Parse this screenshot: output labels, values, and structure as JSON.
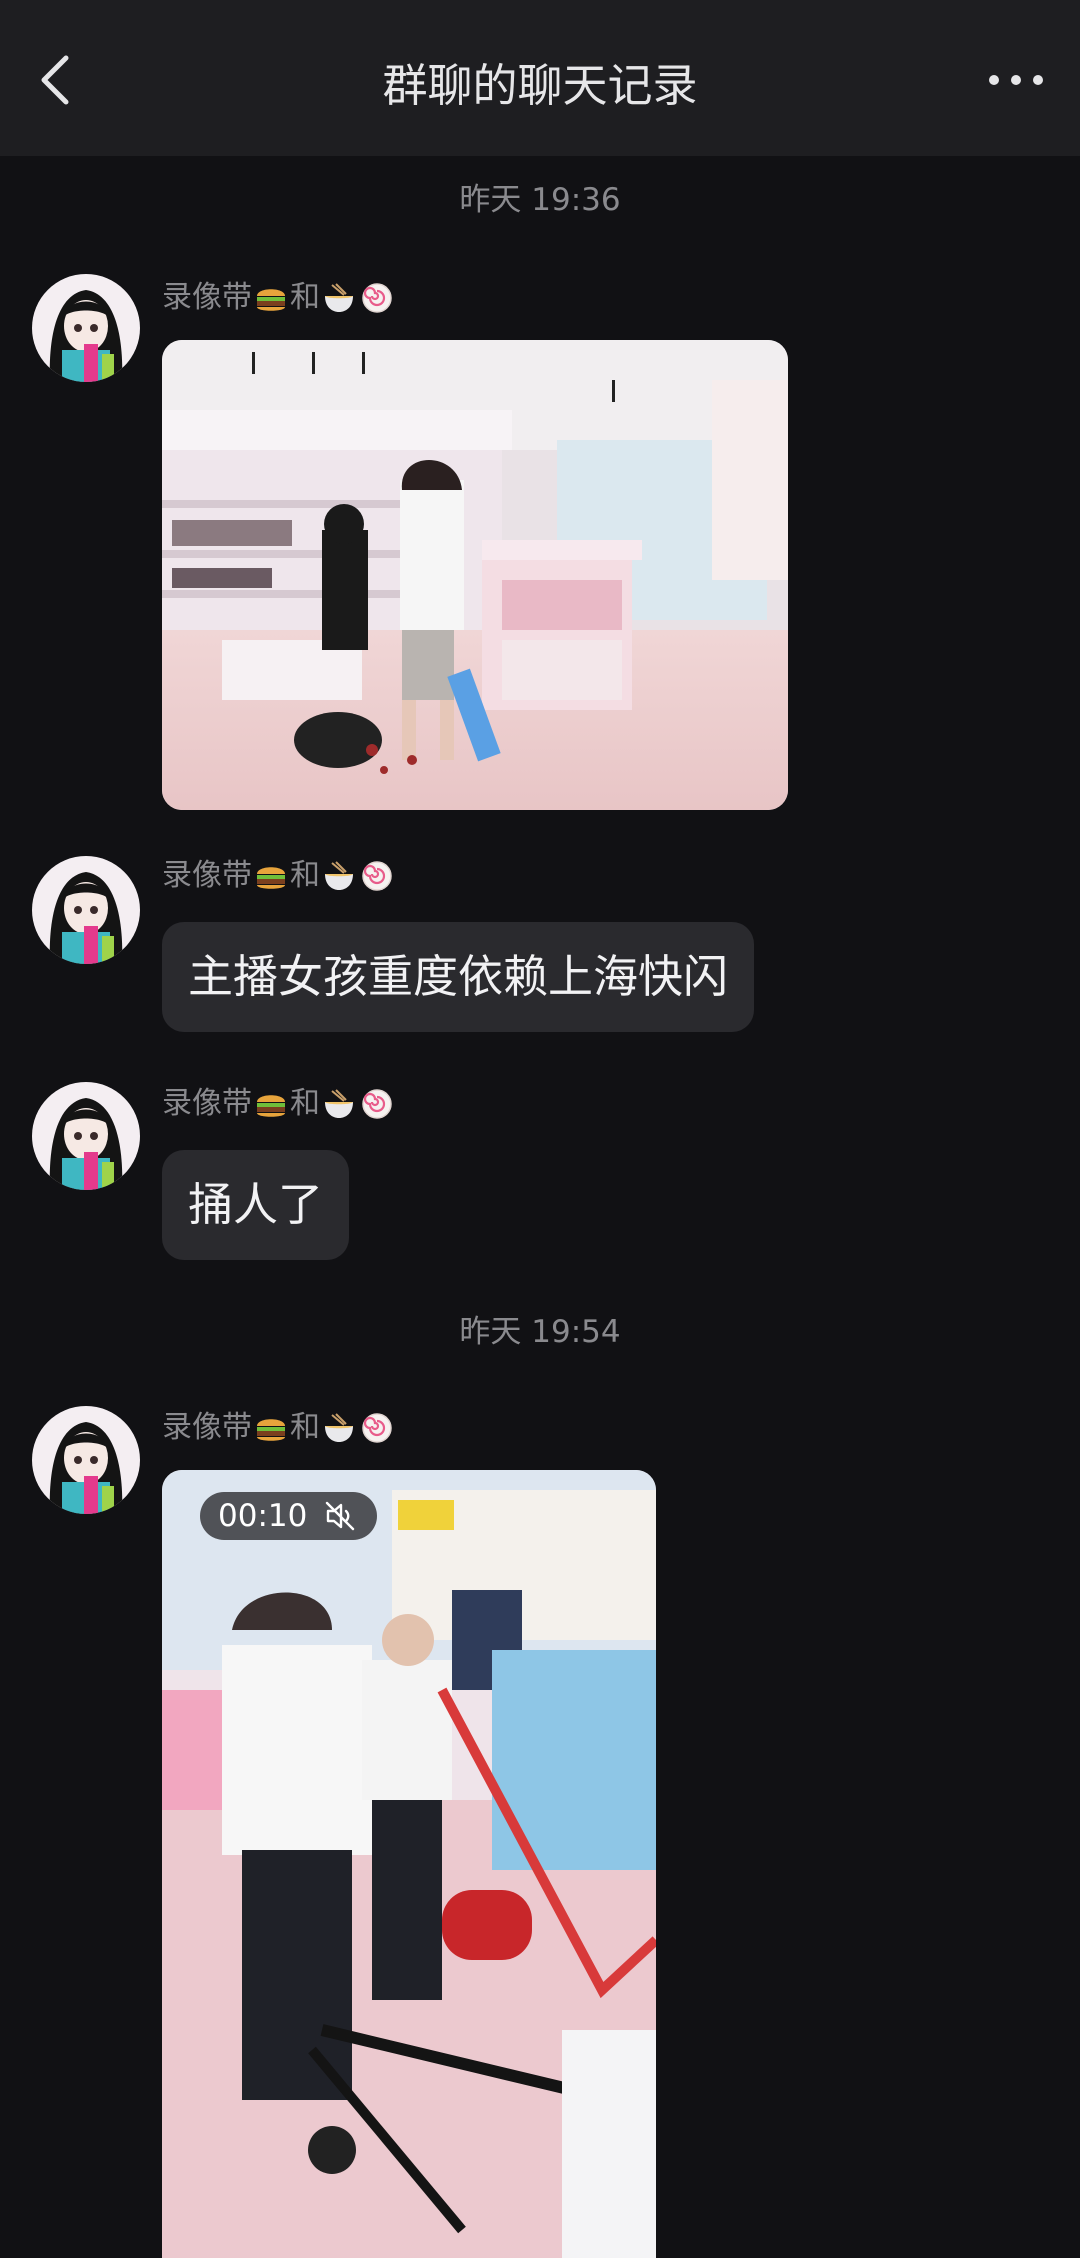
{
  "header": {
    "title": "群聊的聊天记录",
    "back_icon": "chevron-left-icon",
    "more_icon": "more-dots-icon"
  },
  "messages": [
    {
      "timestamp": "昨天 19:36",
      "sender": {
        "name_prefix": "录像带",
        "connector": "和",
        "emojis": [
          "hamburger",
          "ramen-bowl",
          "fish-cake"
        ]
      },
      "type": "image",
      "image_desc": "store interior photo"
    },
    {
      "sender": {
        "name_prefix": "录像带",
        "connector": "和",
        "emojis": [
          "hamburger",
          "ramen-bowl",
          "fish-cake"
        ]
      },
      "type": "text",
      "text": "主播女孩重度依赖上海快闪"
    },
    {
      "sender": {
        "name_prefix": "录像带",
        "connector": "和",
        "emojis": [
          "hamburger",
          "ramen-bowl",
          "fish-cake"
        ]
      },
      "type": "text",
      "text": "捅人了"
    },
    {
      "timestamp": "昨天 19:54",
      "sender": {
        "name_prefix": "录像带",
        "connector": "和",
        "emojis": [
          "hamburger",
          "ramen-bowl",
          "fish-cake"
        ]
      },
      "type": "video",
      "duration": "00:10",
      "muted_icon": "speaker-muted-icon"
    }
  ],
  "colors": {
    "background": "#111114",
    "header": "#1e1e21",
    "bubble": "#2a2a2e",
    "text_primary": "#f2f2f4",
    "text_secondary": "#8a8a8e"
  }
}
